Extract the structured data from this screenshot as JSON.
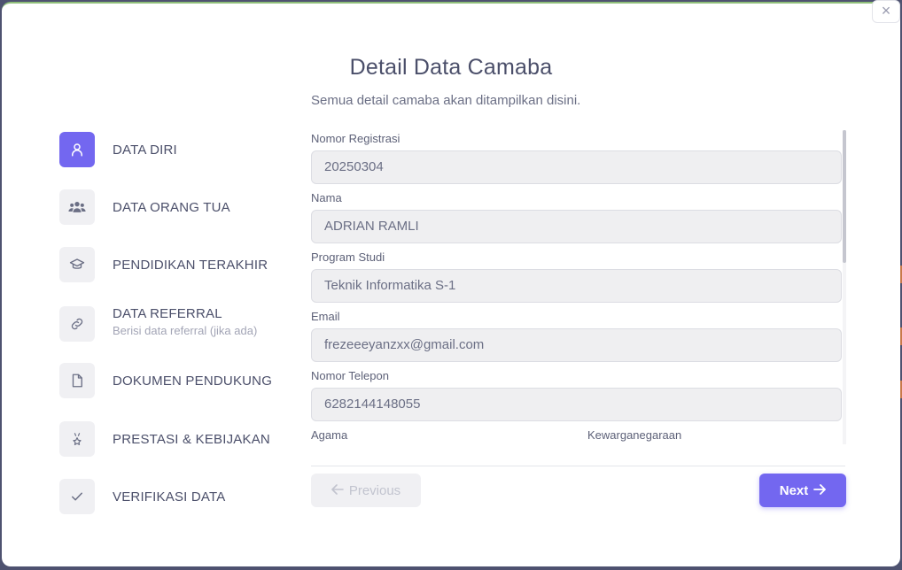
{
  "modal": {
    "title": "Detail Data Camaba",
    "subtitle": "Semua detail camaba akan ditampilkan disini.",
    "close_glyph": "×"
  },
  "steps": [
    {
      "label": "DATA DIRI",
      "sub": "",
      "icon": "user-icon",
      "active": true
    },
    {
      "label": "DATA ORANG TUA",
      "sub": "",
      "icon": "users-icon",
      "active": false
    },
    {
      "label": "PENDIDIKAN TERAKHIR",
      "sub": "",
      "icon": "graduation-cap-icon",
      "active": false
    },
    {
      "label": "DATA REFERRAL",
      "sub": "Berisi data referral (jika ada)",
      "icon": "link-icon",
      "active": false
    },
    {
      "label": "DOKUMEN PENDUKUNG",
      "sub": "",
      "icon": "file-icon",
      "active": false
    },
    {
      "label": "PRESTASI & KEBIJAKAN",
      "sub": "",
      "icon": "medal-icon",
      "active": false
    },
    {
      "label": "VERIFIKASI DATA",
      "sub": "",
      "icon": "check-icon",
      "active": false
    }
  ],
  "form": {
    "nomor_registrasi": {
      "label": "Nomor Registrasi",
      "value": "20250304"
    },
    "nama": {
      "label": "Nama",
      "value": "ADRIAN RAMLI"
    },
    "program_studi": {
      "label": "Program Studi",
      "value": "Teknik Informatika S-1"
    },
    "email": {
      "label": "Email",
      "value": "frezeeeyanzxx@gmail.com"
    },
    "nomor_telepon": {
      "label": "Nomor Telepon",
      "value": "6282144148055"
    },
    "agama": {
      "label": "Agama"
    },
    "kewarganegaraan": {
      "label": "Kewarganegaraan"
    }
  },
  "buttons": {
    "previous": "Previous",
    "next": "Next"
  },
  "colors": {
    "accent": "#7367f0"
  }
}
